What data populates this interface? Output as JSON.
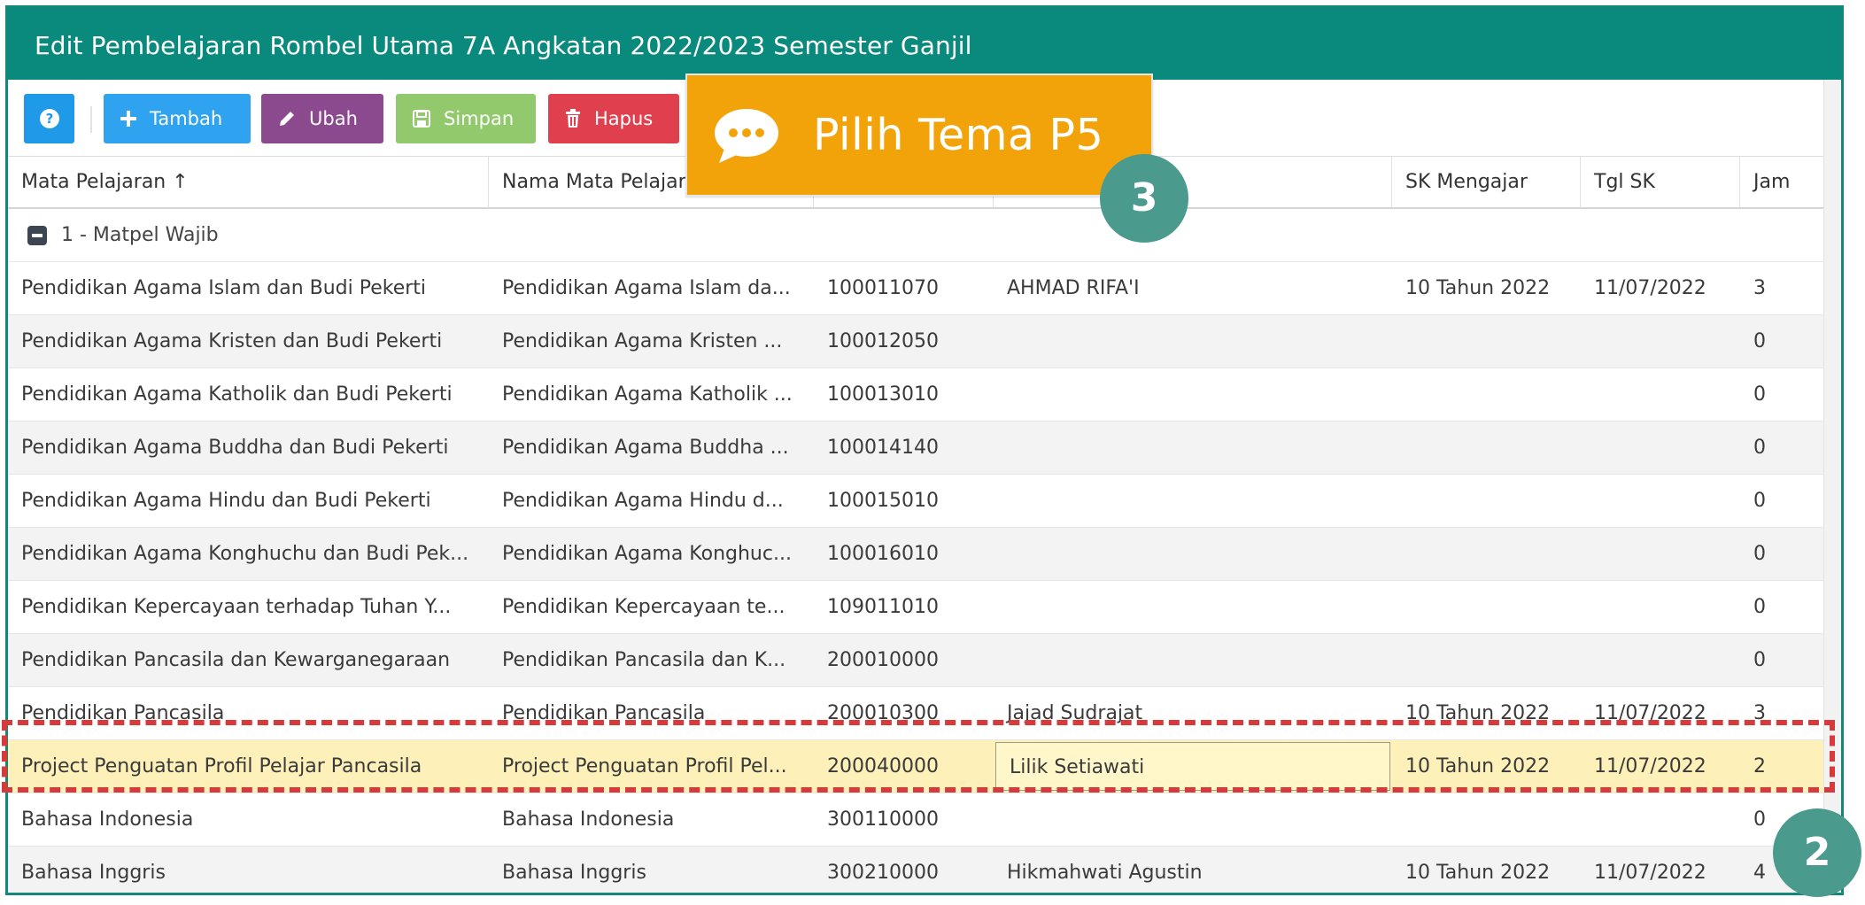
{
  "window": {
    "title": "Edit Pembelajaran Rombel Utama 7A Angkatan 2022/2023 Semester Ganjil"
  },
  "toolbar": {
    "help_icon": "question-circle-icon",
    "add_label": "Tambah",
    "edit_label": "Ubah",
    "save_label": "Simpan",
    "delete_label": "Hapus"
  },
  "callout": {
    "text": "Pilih Tema P5",
    "icon": "speech-bubble-icon"
  },
  "badges": {
    "step_3": "3",
    "step_2": "2"
  },
  "table": {
    "columns": [
      "Mata Pelajaran ↑",
      "Nama Mata Pelajaran",
      "",
      "",
      "SK Mengajar",
      "Tgl SK",
      "Jam"
    ],
    "group_label": "1 - Matpel Wajib",
    "rows": [
      {
        "mapel": "Pendidikan Agama Islam dan Budi Pekerti",
        "nama": "Pendidikan Agama Islam da...",
        "kode": "100011070",
        "ptk": "AHMAD RIFA'I",
        "sk": "10 Tahun 2022",
        "tgl": "11/07/2022",
        "jam": "3"
      },
      {
        "mapel": "Pendidikan Agama Kristen dan Budi Pekerti",
        "nama": "Pendidikan Agama Kristen ...",
        "kode": "100012050",
        "ptk": "",
        "sk": "",
        "tgl": "",
        "jam": "0"
      },
      {
        "mapel": "Pendidikan Agama Katholik dan Budi Pekerti",
        "nama": "Pendidikan Agama Katholik ...",
        "kode": "100013010",
        "ptk": "",
        "sk": "",
        "tgl": "",
        "jam": "0"
      },
      {
        "mapel": "Pendidikan Agama Buddha dan Budi Pekerti",
        "nama": "Pendidikan Agama Buddha ...",
        "kode": "100014140",
        "ptk": "",
        "sk": "",
        "tgl": "",
        "jam": "0"
      },
      {
        "mapel": "Pendidikan Agama Hindu dan Budi Pekerti",
        "nama": "Pendidikan Agama Hindu d...",
        "kode": "100015010",
        "ptk": "",
        "sk": "",
        "tgl": "",
        "jam": "0"
      },
      {
        "mapel": "Pendidikan Agama Konghuchu dan Budi Pek...",
        "nama": "Pendidikan Agama Konghuc...",
        "kode": "100016010",
        "ptk": "",
        "sk": "",
        "tgl": "",
        "jam": "0"
      },
      {
        "mapel": "Pendidikan Kepercayaan terhadap Tuhan Y...",
        "nama": "Pendidikan Kepercayaan te...",
        "kode": "109011010",
        "ptk": "",
        "sk": "",
        "tgl": "",
        "jam": "0"
      },
      {
        "mapel": "Pendidikan Pancasila dan Kewarganegaraan",
        "nama": "Pendidikan Pancasila dan K...",
        "kode": "200010000",
        "ptk": "",
        "sk": "",
        "tgl": "",
        "jam": "0"
      },
      {
        "mapel": "Pendidikan Pancasila",
        "nama": "Pendidikan Pancasila",
        "kode": "200010300",
        "ptk": "Jajad Sudrajat",
        "sk": "10 Tahun 2022",
        "tgl": "11/07/2022",
        "jam": "3"
      },
      {
        "mapel": "Project Penguatan Profil Pelajar Pancasila",
        "nama": "Project Penguatan Profil Pel...",
        "kode": "200040000",
        "ptk": "Lilik Setiawati",
        "sk": "10 Tahun 2022",
        "tgl": "11/07/2022",
        "jam": "2"
      },
      {
        "mapel": "Bahasa Indonesia",
        "nama": "Bahasa Indonesia",
        "kode": "300110000",
        "ptk": "",
        "sk": "",
        "tgl": "",
        "jam": "0"
      },
      {
        "mapel": "Bahasa Inggris",
        "nama": "Bahasa Inggris",
        "kode": "300210000",
        "ptk": "Hikmahwati Agustin",
        "sk": "10 Tahun 2022",
        "tgl": "11/07/2022",
        "jam": "4"
      }
    ]
  },
  "colors": {
    "title_bar": "#0a8a7c",
    "callout": "#f2a30a",
    "badge": "#4a9a8e",
    "selected_row": "#fdf0b8",
    "highlight_dash": "#d63a3a"
  }
}
